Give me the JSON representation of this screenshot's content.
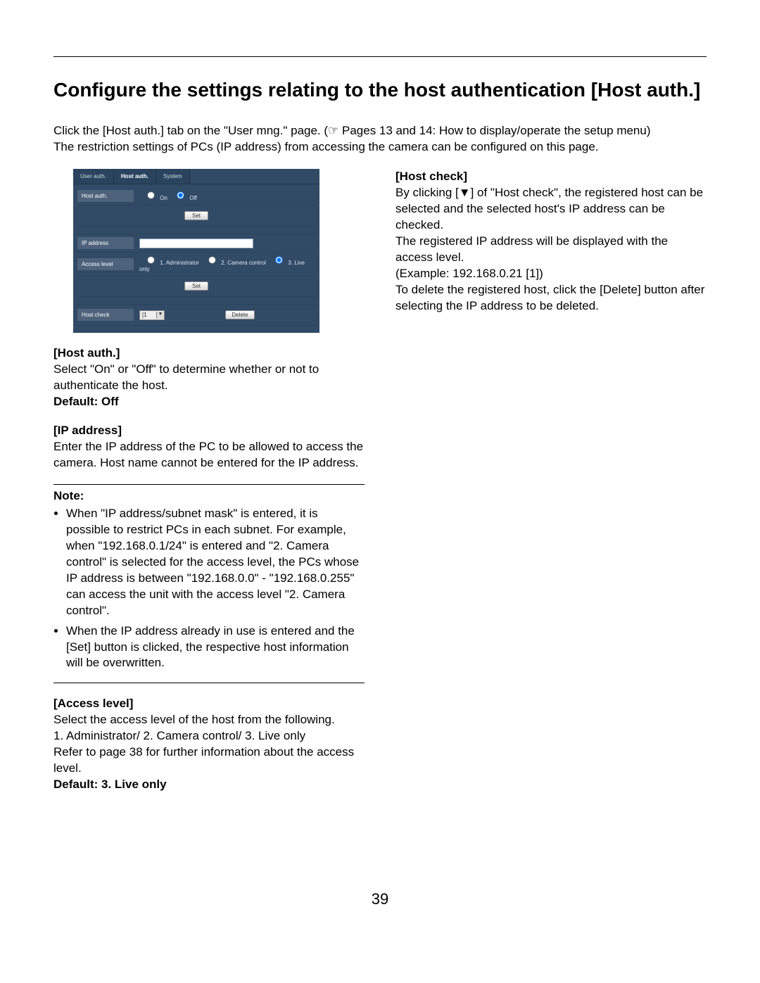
{
  "title": "Configure the settings relating to the host authentication [Host auth.]",
  "intro_line1": "Click the [Host auth.] tab on the \"User mng.\" page. (☞ Pages 13 and 14: How to display/operate the setup menu)",
  "intro_line2": "The restriction settings of PCs (IP address) from accessing the camera can be configured on this page.",
  "ui": {
    "tabs": [
      "User auth.",
      "Host auth.",
      "System"
    ],
    "active_tab_index": 1,
    "rows": {
      "host_auth_label": "Host auth.",
      "host_auth_on": "On",
      "host_auth_off": "Off",
      "host_auth_selected": "Off",
      "set_btn1": "Set",
      "ip_label": "IP address",
      "access_label": "Access level",
      "access_options": [
        "1. Administrator",
        "2. Camera control",
        "3. Live only"
      ],
      "access_selected_index": 2,
      "set_btn2": "Set",
      "hostcheck_label": "Host check",
      "hostcheck_value": "[1 ▼",
      "delete_btn": "Delete"
    }
  },
  "left": {
    "hostauth_head": "[Host auth.]",
    "hostauth_body": "Select \"On\" or \"Off\" to determine whether or not to authenticate the host.",
    "hostauth_default": "Default: Off",
    "ip_head": "[IP address]",
    "ip_body": "Enter the IP address of the PC to be allowed to access the camera. Host name cannot be entered for the IP address.",
    "note_label": "Note:",
    "note_items": [
      "When \"IP address/subnet mask\" is entered, it is possible to restrict PCs in each subnet. For example, when \"192.168.0.1/24\" is entered and \"2. Camera control\" is selected for the access level, the PCs whose IP address is between \"192.168.0.0\" - \"192.168.0.255\" can access the unit with the access level \"2. Camera control\".",
      "When the IP address already in use is entered and the [Set] button is clicked, the respective host information will be overwritten."
    ],
    "access_head": "[Access level]",
    "access_body1": "Select the access level of the host from the following.",
    "access_body2": "1. Administrator/ 2. Camera control/ 3. Live only",
    "access_body3": "Refer to page 38 for further information about the access level.",
    "access_default": "Default: 3. Live only"
  },
  "right": {
    "hostcheck_head": "[Host check]",
    "hostcheck_body1": "By clicking [▼] of \"Host check\", the registered host can be selected and the selected host's IP address can be checked.",
    "hostcheck_body2": "The registered IP address will be displayed with the access level.",
    "hostcheck_example": "(Example: 192.168.0.21 [1])",
    "hostcheck_body3": "To delete the registered host, click the [Delete] button after selecting the IP address to be deleted."
  },
  "page_number": "39"
}
